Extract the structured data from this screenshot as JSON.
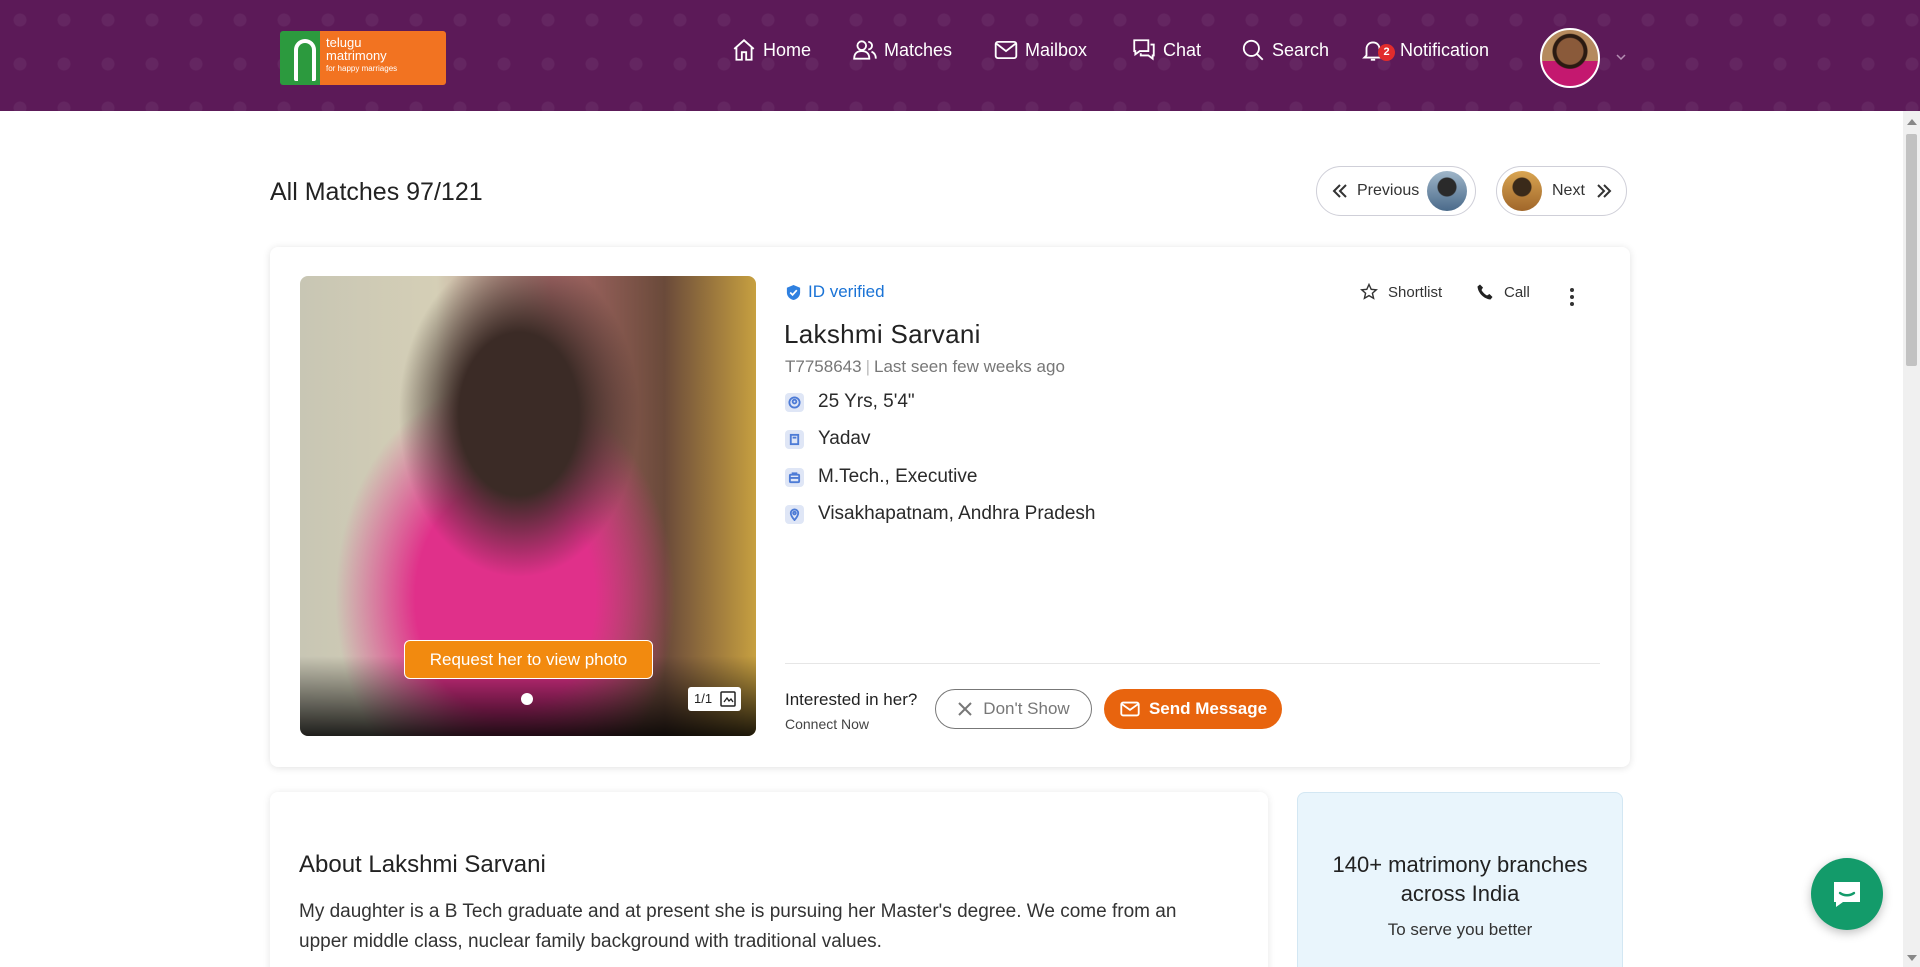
{
  "brand": {
    "logo_line1": "telugu",
    "logo_line2": "matrimony",
    "logo_tagline": "for happy marriages"
  },
  "nav": {
    "home": "Home",
    "matches": "Matches",
    "mailbox": "Mailbox",
    "chat": "Chat",
    "search": "Search",
    "notification": "Notification",
    "notification_count": "2"
  },
  "pager": {
    "title": "All Matches 97/121",
    "previous": "Previous",
    "next": "Next"
  },
  "profile": {
    "verified_label": "ID verified",
    "name": "Lakshmi Sarvani",
    "id": "T7758643",
    "last_seen": "Last seen few weeks ago",
    "age_height": "25 Yrs, 5'4\"",
    "caste": "Yadav",
    "education_job": "M.Tech., Executive",
    "location": "Visakhapatnam, Andhra Pradesh",
    "photo_request": "Request her to view photo",
    "photo_count": "1/1",
    "shortlist": "Shortlist",
    "call": "Call",
    "interest_question": "Interested in her?",
    "interest_sub": "Connect Now",
    "dont_show": "Don't Show",
    "send_message": "Send Message"
  },
  "about": {
    "heading": "About Lakshmi Sarvani",
    "text": "My daughter is a B Tech graduate and at present she is pursuing her Master's degree. We come from an upper middle class, nuclear family background with traditional values."
  },
  "branches": {
    "title": "140+ matrimony branches across India",
    "subtitle": "To serve you better"
  },
  "colors": {
    "header_bg": "#5c1a58",
    "accent_orange": "#e8640e",
    "verified_blue": "#1a73d6",
    "chat_green": "#139b6a"
  }
}
